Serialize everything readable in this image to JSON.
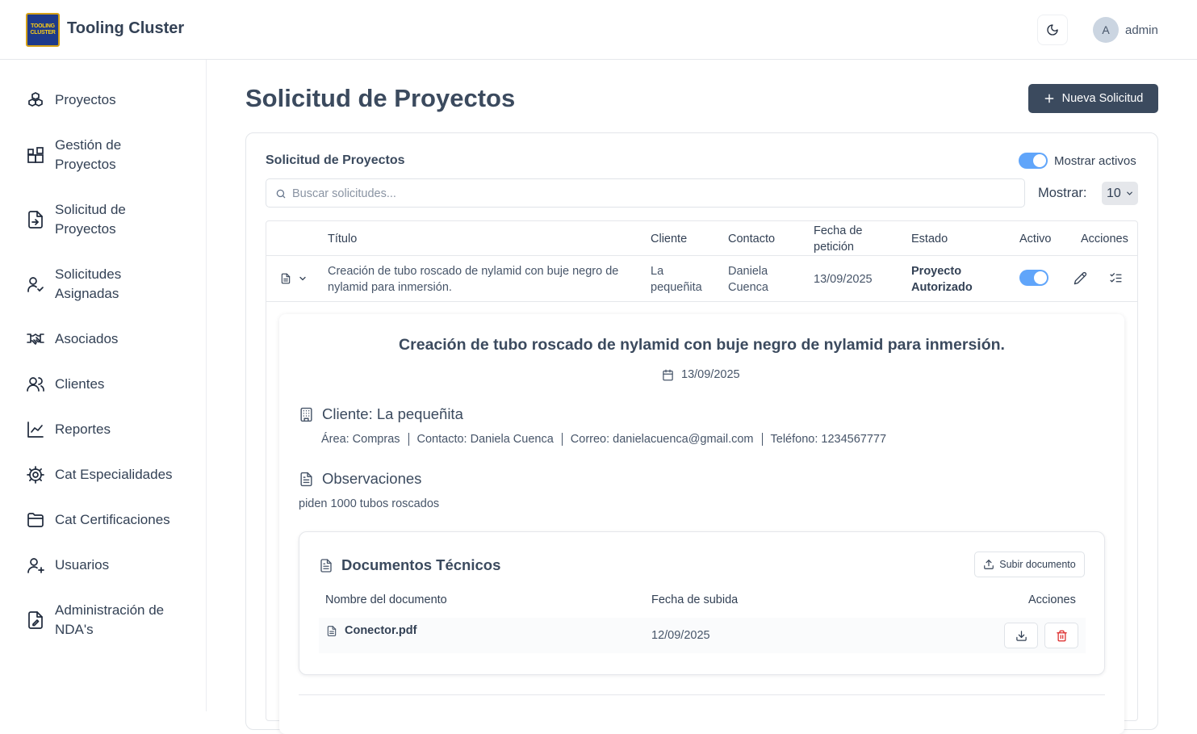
{
  "app": {
    "brand": "Tooling Cluster",
    "logo_text": [
      "TOOLING",
      "CLUSTER"
    ],
    "user_initial": "A",
    "username": "admin"
  },
  "sidebar": {
    "items": [
      {
        "label": "Proyectos",
        "icon": "boxes-icon"
      },
      {
        "label": "Gestión de Proyectos",
        "icon": "blocks-icon"
      },
      {
        "label": "Solicitud de Proyectos",
        "icon": "file-input-icon"
      },
      {
        "label": "Solicitudes Asignadas",
        "icon": "user-check-icon"
      },
      {
        "label": "Asociados",
        "icon": "handshake-icon"
      },
      {
        "label": "Clientes",
        "icon": "users-icon"
      },
      {
        "label": "Reportes",
        "icon": "line-chart-icon"
      },
      {
        "label": "Cat Especialidades",
        "icon": "cog-icon"
      },
      {
        "label": "Cat Certificaciones",
        "icon": "folder-icon"
      },
      {
        "label": "Usuarios",
        "icon": "user-plus-icon"
      },
      {
        "label": "Administración de NDA's",
        "icon": "file-signature-icon"
      }
    ]
  },
  "main": {
    "title": "Solicitud de Proyectos",
    "new_button": "Nueva Solicitud",
    "card_title": "Solicitud de Proyectos",
    "active_toggle_label": "Mostrar activos",
    "search_placeholder": "Buscar solicitudes...",
    "show_label": "Mostrar:",
    "show_value": "10"
  },
  "table": {
    "headers": {
      "titulo": "Título",
      "cliente": "Cliente",
      "contacto": "Contacto",
      "fecha": "Fecha de petición",
      "estado": "Estado",
      "activo": "Activo",
      "acciones": "Acciones"
    },
    "rows": [
      {
        "titulo": "Creación de tubo roscado de nylamid con buje negro de nylamid para inmersión.",
        "cliente": "La pequeñita",
        "contacto": "Daniela Cuenca",
        "fecha": "13/09/2025",
        "estado": "Proyecto Autorizado",
        "activo": true
      }
    ]
  },
  "detail": {
    "title": "Creación de tubo roscado de nylamid con buje negro de nylamid para inmersión.",
    "date": "13/09/2025",
    "client_heading": "Cliente: La pequeñita",
    "area": "Área: Compras",
    "contact": "Contacto: Daniela Cuenca",
    "email": "Correo: danielacuenca@gmail.com",
    "phone": "Teléfono: 1234567777",
    "obs_heading": "Observaciones",
    "obs_text": "piden 1000 tubos roscados",
    "docs_heading": "Documentos Técnicos",
    "upload_button": "Subir documento",
    "docs_headers": {
      "name": "Nombre del documento",
      "date": "Fecha de subida",
      "actions": "Acciones"
    },
    "documents": [
      {
        "name": "Conector.pdf",
        "date": "12/09/2025"
      }
    ]
  },
  "colors": {
    "primary": "#3b4a5e",
    "toggle": "#60a5fa",
    "danger": "#dc2626"
  }
}
